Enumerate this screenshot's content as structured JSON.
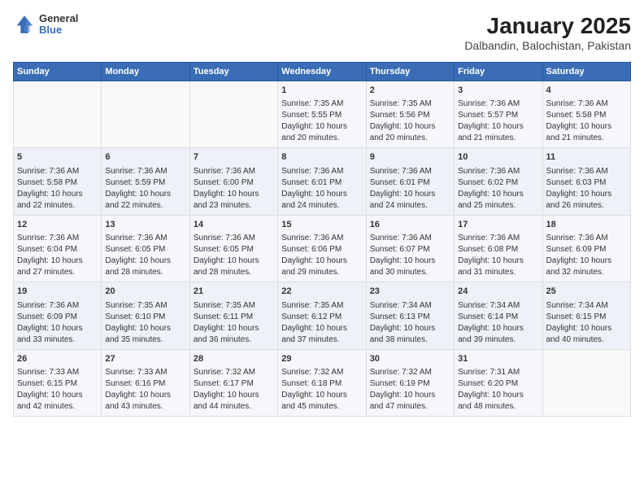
{
  "header": {
    "logo_general": "General",
    "logo_blue": "Blue",
    "title": "January 2025",
    "subtitle": "Dalbandin, Balochistan, Pakistan"
  },
  "weekdays": [
    "Sunday",
    "Monday",
    "Tuesday",
    "Wednesday",
    "Thursday",
    "Friday",
    "Saturday"
  ],
  "weeks": [
    [
      {
        "day": "",
        "sunrise": "",
        "sunset": "",
        "daylight": ""
      },
      {
        "day": "",
        "sunrise": "",
        "sunset": "",
        "daylight": ""
      },
      {
        "day": "",
        "sunrise": "",
        "sunset": "",
        "daylight": ""
      },
      {
        "day": "1",
        "sunrise": "Sunrise: 7:35 AM",
        "sunset": "Sunset: 5:55 PM",
        "daylight": "Daylight: 10 hours and 20 minutes."
      },
      {
        "day": "2",
        "sunrise": "Sunrise: 7:35 AM",
        "sunset": "Sunset: 5:56 PM",
        "daylight": "Daylight: 10 hours and 20 minutes."
      },
      {
        "day": "3",
        "sunrise": "Sunrise: 7:36 AM",
        "sunset": "Sunset: 5:57 PM",
        "daylight": "Daylight: 10 hours and 21 minutes."
      },
      {
        "day": "4",
        "sunrise": "Sunrise: 7:36 AM",
        "sunset": "Sunset: 5:58 PM",
        "daylight": "Daylight: 10 hours and 21 minutes."
      }
    ],
    [
      {
        "day": "5",
        "sunrise": "Sunrise: 7:36 AM",
        "sunset": "Sunset: 5:58 PM",
        "daylight": "Daylight: 10 hours and 22 minutes."
      },
      {
        "day": "6",
        "sunrise": "Sunrise: 7:36 AM",
        "sunset": "Sunset: 5:59 PM",
        "daylight": "Daylight: 10 hours and 22 minutes."
      },
      {
        "day": "7",
        "sunrise": "Sunrise: 7:36 AM",
        "sunset": "Sunset: 6:00 PM",
        "daylight": "Daylight: 10 hours and 23 minutes."
      },
      {
        "day": "8",
        "sunrise": "Sunrise: 7:36 AM",
        "sunset": "Sunset: 6:01 PM",
        "daylight": "Daylight: 10 hours and 24 minutes."
      },
      {
        "day": "9",
        "sunrise": "Sunrise: 7:36 AM",
        "sunset": "Sunset: 6:01 PM",
        "daylight": "Daylight: 10 hours and 24 minutes."
      },
      {
        "day": "10",
        "sunrise": "Sunrise: 7:36 AM",
        "sunset": "Sunset: 6:02 PM",
        "daylight": "Daylight: 10 hours and 25 minutes."
      },
      {
        "day": "11",
        "sunrise": "Sunrise: 7:36 AM",
        "sunset": "Sunset: 6:03 PM",
        "daylight": "Daylight: 10 hours and 26 minutes."
      }
    ],
    [
      {
        "day": "12",
        "sunrise": "Sunrise: 7:36 AM",
        "sunset": "Sunset: 6:04 PM",
        "daylight": "Daylight: 10 hours and 27 minutes."
      },
      {
        "day": "13",
        "sunrise": "Sunrise: 7:36 AM",
        "sunset": "Sunset: 6:05 PM",
        "daylight": "Daylight: 10 hours and 28 minutes."
      },
      {
        "day": "14",
        "sunrise": "Sunrise: 7:36 AM",
        "sunset": "Sunset: 6:05 PM",
        "daylight": "Daylight: 10 hours and 28 minutes."
      },
      {
        "day": "15",
        "sunrise": "Sunrise: 7:36 AM",
        "sunset": "Sunset: 6:06 PM",
        "daylight": "Daylight: 10 hours and 29 minutes."
      },
      {
        "day": "16",
        "sunrise": "Sunrise: 7:36 AM",
        "sunset": "Sunset: 6:07 PM",
        "daylight": "Daylight: 10 hours and 30 minutes."
      },
      {
        "day": "17",
        "sunrise": "Sunrise: 7:36 AM",
        "sunset": "Sunset: 6:08 PM",
        "daylight": "Daylight: 10 hours and 31 minutes."
      },
      {
        "day": "18",
        "sunrise": "Sunrise: 7:36 AM",
        "sunset": "Sunset: 6:09 PM",
        "daylight": "Daylight: 10 hours and 32 minutes."
      }
    ],
    [
      {
        "day": "19",
        "sunrise": "Sunrise: 7:36 AM",
        "sunset": "Sunset: 6:09 PM",
        "daylight": "Daylight: 10 hours and 33 minutes."
      },
      {
        "day": "20",
        "sunrise": "Sunrise: 7:35 AM",
        "sunset": "Sunset: 6:10 PM",
        "daylight": "Daylight: 10 hours and 35 minutes."
      },
      {
        "day": "21",
        "sunrise": "Sunrise: 7:35 AM",
        "sunset": "Sunset: 6:11 PM",
        "daylight": "Daylight: 10 hours and 36 minutes."
      },
      {
        "day": "22",
        "sunrise": "Sunrise: 7:35 AM",
        "sunset": "Sunset: 6:12 PM",
        "daylight": "Daylight: 10 hours and 37 minutes."
      },
      {
        "day": "23",
        "sunrise": "Sunrise: 7:34 AM",
        "sunset": "Sunset: 6:13 PM",
        "daylight": "Daylight: 10 hours and 38 minutes."
      },
      {
        "day": "24",
        "sunrise": "Sunrise: 7:34 AM",
        "sunset": "Sunset: 6:14 PM",
        "daylight": "Daylight: 10 hours and 39 minutes."
      },
      {
        "day": "25",
        "sunrise": "Sunrise: 7:34 AM",
        "sunset": "Sunset: 6:15 PM",
        "daylight": "Daylight: 10 hours and 40 minutes."
      }
    ],
    [
      {
        "day": "26",
        "sunrise": "Sunrise: 7:33 AM",
        "sunset": "Sunset: 6:15 PM",
        "daylight": "Daylight: 10 hours and 42 minutes."
      },
      {
        "day": "27",
        "sunrise": "Sunrise: 7:33 AM",
        "sunset": "Sunset: 6:16 PM",
        "daylight": "Daylight: 10 hours and 43 minutes."
      },
      {
        "day": "28",
        "sunrise": "Sunrise: 7:32 AM",
        "sunset": "Sunset: 6:17 PM",
        "daylight": "Daylight: 10 hours and 44 minutes."
      },
      {
        "day": "29",
        "sunrise": "Sunrise: 7:32 AM",
        "sunset": "Sunset: 6:18 PM",
        "daylight": "Daylight: 10 hours and 45 minutes."
      },
      {
        "day": "30",
        "sunrise": "Sunrise: 7:32 AM",
        "sunset": "Sunset: 6:19 PM",
        "daylight": "Daylight: 10 hours and 47 minutes."
      },
      {
        "day": "31",
        "sunrise": "Sunrise: 7:31 AM",
        "sunset": "Sunset: 6:20 PM",
        "daylight": "Daylight: 10 hours and 48 minutes."
      },
      {
        "day": "",
        "sunrise": "",
        "sunset": "",
        "daylight": ""
      }
    ]
  ]
}
